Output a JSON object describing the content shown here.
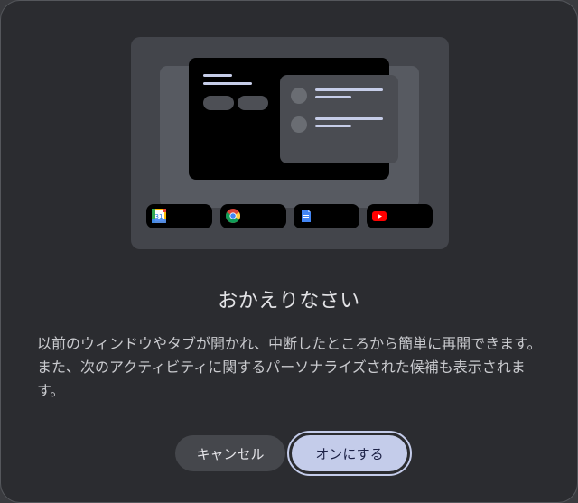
{
  "dialog": {
    "title": "おかえりなさい",
    "body": "以前のウィンドウやタブが開かれ、中断したところから簡単に再開できます。また、次のアクティビティに関するパーソナライズされた候補も表示されます。",
    "buttons": {
      "cancel_label": "キャンセル",
      "confirm_label": "オンにする"
    }
  },
  "illustration": {
    "apps": [
      {
        "name": "calendar-icon",
        "label": "31"
      },
      {
        "name": "chrome-icon"
      },
      {
        "name": "docs-icon"
      },
      {
        "name": "youtube-icon"
      }
    ]
  },
  "colors": {
    "dialog_bg": "#2b2c30",
    "accent": "#c4ccea",
    "accent_text": "#1c2145",
    "cancel_bg": "#45474c"
  }
}
